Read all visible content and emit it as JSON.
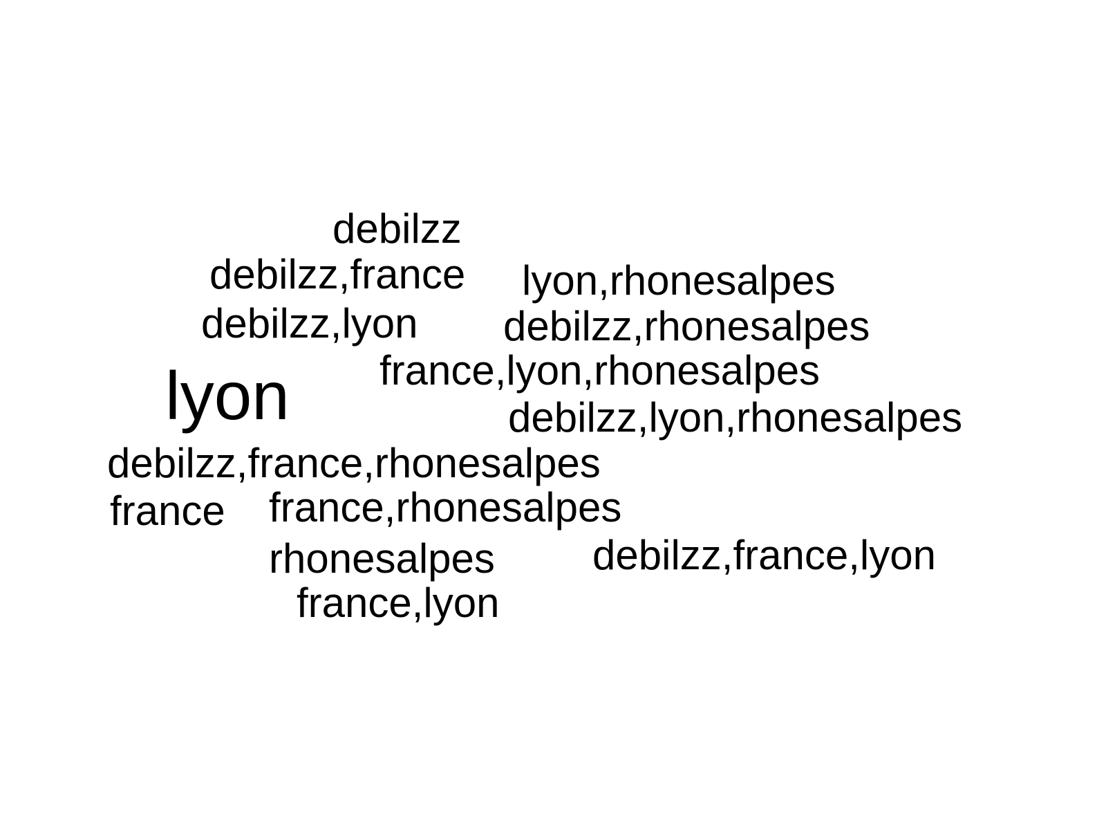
{
  "words": [
    "debilzz",
    "debilzz,france",
    "lyon,rhonesalpes",
    "debilzz,lyon",
    "debilzz,rhonesalpes",
    "france,lyon,rhonesalpes",
    "lyon",
    "debilzz,lyon,rhonesalpes",
    "debilzz,france,rhonesalpes",
    "france",
    "france,rhonesalpes",
    "debilzz,france,lyon",
    "rhonesalpes",
    "france,lyon"
  ],
  "colors": {
    "background": "#ffffff",
    "text": "#000000"
  }
}
